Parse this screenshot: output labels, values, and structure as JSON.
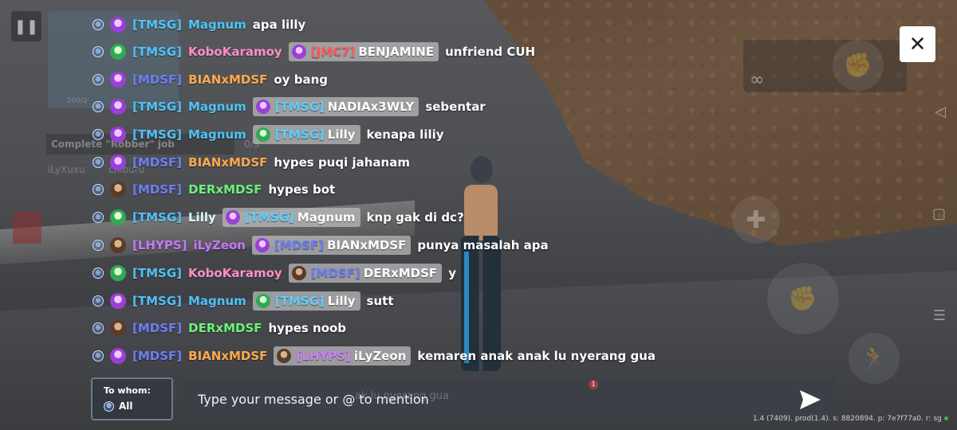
{
  "hud": {
    "objective_text": "Complete \"Robber\" job",
    "objective_count": "0/3",
    "bg_username": "iLyXuxu",
    "bg_username_suffix": "chiburu",
    "minimap_health": "200/2",
    "infinity": "∞",
    "ghost_preview": "ak lu nyerang gua",
    "ghost_badge": "1"
  },
  "close_label": "✕",
  "chat": {
    "messages": [
      {
        "tag": "[TMSG]",
        "name": "Magnum",
        "message": "apa lilly"
      },
      {
        "tag": "[TMSG]",
        "name": "KoboKaramoy",
        "mention_tag": "[JMC7]",
        "mention_name": "BENJAMINE",
        "message": "unfriend CUH"
      },
      {
        "tag": "[MDSF]",
        "name": "BIANxMDSF",
        "message": "oy bang"
      },
      {
        "tag": "[TMSG]",
        "name": "Magnum",
        "mention_tag": "[TMSG]",
        "mention_name": "NADIAx3WLY",
        "message": "sebentar"
      },
      {
        "tag": "[TMSG]",
        "name": "Magnum",
        "mention_tag": "[TMSG]",
        "mention_name": "Lilly",
        "message": "kenapa liliy"
      },
      {
        "tag": "[MDSF]",
        "name": "BIANxMDSF",
        "message": "hypes puqi jahanam"
      },
      {
        "tag": "[MDSF]",
        "name": "DERxMDSF",
        "message": "hypes bot"
      },
      {
        "tag": "[TMSG]",
        "name": "Lilly",
        "mention_tag": "[TMSG]",
        "mention_name": "Magnum",
        "message": "knp gak di dc?"
      },
      {
        "tag": "[LHYPS]",
        "name": "iLyZeon",
        "mention_tag": "[MDSF]",
        "mention_name": "BIANxMDSF",
        "message": "punya masalah apa"
      },
      {
        "tag": "[TMSG]",
        "name": "KoboKaramoy",
        "mention_tag": "[MDSF]",
        "mention_name": "DERxMDSF",
        "message": "y"
      },
      {
        "tag": "[TMSG]",
        "name": "Magnum",
        "mention_tag": "[TMSG]",
        "mention_name": "Lilly",
        "message": "sutt"
      },
      {
        "tag": "[MDSF]",
        "name": "DERxMDSF",
        "message": "hypes noob"
      },
      {
        "tag": "[MDSF]",
        "name": "BIANxMDSF",
        "mention_tag": "[LHYPS]",
        "mention_name": "iLyZeon",
        "message": "kemaren anak anak lu nyerang gua"
      }
    ]
  },
  "recipient": {
    "label": "To whom:",
    "value": "All"
  },
  "input": {
    "placeholder": "Type your message or @ to mention"
  },
  "version_text": "1.4 (7409). prod(1.4). s: 8820894. p: 7e7f77a0. r: sg",
  "colors": {
    "tmsg": "#4fc3f7",
    "mdsf": "#6f7ff5",
    "lhyps": "#c678ff",
    "jmc7": "#ff5b5b",
    "send": "#ffffff"
  }
}
